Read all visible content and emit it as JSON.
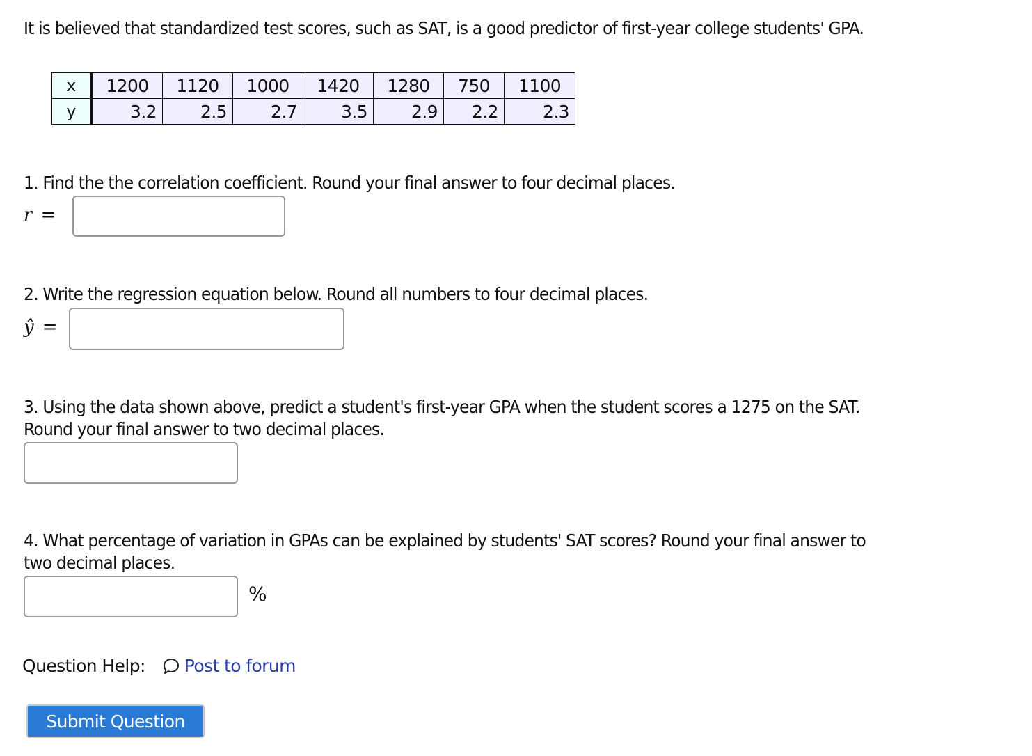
{
  "intro": "It is believed that standardized test scores, such as SAT, is a good predictor of first-year college students' GPA.",
  "table": {
    "row_labels": [
      "x",
      "y"
    ],
    "x": [
      "1200",
      "1120",
      "1000",
      "1420",
      "1280",
      "750",
      "1100"
    ],
    "y": [
      "3.2",
      "2.5",
      "2.7",
      "3.5",
      "2.9",
      "2.2",
      "2.3"
    ]
  },
  "questions": [
    {
      "text": "1. Find the the correlation coefficient. Round your final answer to four decimal places.",
      "math_label": "r",
      "equals": "=",
      "answer_value": "",
      "answer_placeholder": ""
    },
    {
      "text": "2. Write the regression equation below. Round all numbers to four decimal places.",
      "math_label": "ŷ",
      "equals": "=",
      "answer_value": "",
      "answer_placeholder": ""
    },
    {
      "text_line1": "3. Using the data shown above, predict a student's first-year GPA when the student scores a 1275 on the SAT.",
      "text_line2": "Round your final answer to two decimal places.",
      "answer_value": "",
      "answer_placeholder": ""
    },
    {
      "text_line1": "4. What percentage of variation in GPAs can be explained by students' SAT scores? Round your final answer to",
      "text_line2": "two decimal places.",
      "answer_value": "",
      "answer_placeholder": "",
      "unit": "%"
    }
  ],
  "help": {
    "label": "Question Help:",
    "icon": "chat-bubble-icon",
    "link_text": "Post to forum"
  },
  "submit_label": "Submit Question",
  "colors": {
    "link": "#2b3fa8",
    "button": "#2a7bd5",
    "table_header_bg": "#effefe",
    "table_cell_bg": "#eeeefe"
  }
}
